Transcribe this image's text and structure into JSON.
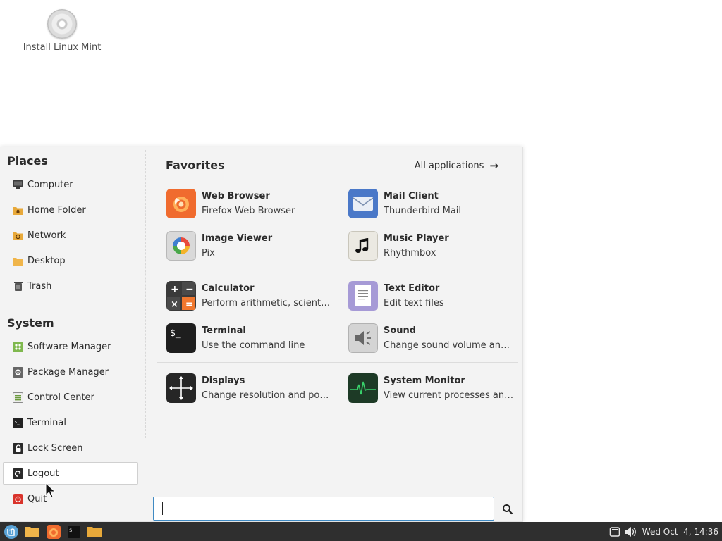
{
  "desktop": {
    "icons": [
      {
        "label": "Install Linux Mint",
        "icon": "disc-icon"
      }
    ]
  },
  "menu": {
    "places": {
      "title": "Places",
      "items": [
        {
          "label": "Computer",
          "icon": "computer-icon"
        },
        {
          "label": "Home Folder",
          "icon": "home-folder-icon"
        },
        {
          "label": "Network",
          "icon": "network-icon"
        },
        {
          "label": "Desktop",
          "icon": "desktop-folder-icon"
        },
        {
          "label": "Trash",
          "icon": "trash-icon"
        }
      ]
    },
    "system": {
      "title": "System",
      "items": [
        {
          "label": "Software Manager",
          "icon": "software-manager-icon"
        },
        {
          "label": "Package Manager",
          "icon": "package-manager-icon"
        },
        {
          "label": "Control Center",
          "icon": "control-center-icon"
        },
        {
          "label": "Terminal",
          "icon": "terminal-icon"
        },
        {
          "label": "Lock Screen",
          "icon": "lock-icon"
        },
        {
          "label": "Logout",
          "icon": "logout-icon"
        },
        {
          "label": "Quit",
          "icon": "power-icon"
        }
      ]
    },
    "favorites": {
      "title": "Favorites",
      "all_apps_label": "All applications",
      "apps": [
        {
          "name": "Web Browser",
          "desc": "Firefox Web Browser",
          "icon": "firefox-icon"
        },
        {
          "name": "Mail Client",
          "desc": "Thunderbird Mail",
          "icon": "mail-icon"
        },
        {
          "name": "Image Viewer",
          "desc": "Pix",
          "icon": "image-viewer-icon"
        },
        {
          "name": "Music Player",
          "desc": "Rhythmbox",
          "icon": "music-icon"
        },
        {
          "name": "Calculator",
          "desc": "Perform arithmetic, scientific or financial calculations",
          "icon": "calculator-icon"
        },
        {
          "name": "Text Editor",
          "desc": "Edit text files",
          "icon": "text-editor-icon"
        },
        {
          "name": "Terminal",
          "desc": "Use the command line",
          "icon": "terminal-icon"
        },
        {
          "name": "Sound",
          "desc": "Change sound volume and sound events",
          "icon": "sound-icon"
        },
        {
          "name": "Displays",
          "desc": "Change resolution and position of monitors",
          "icon": "displays-icon"
        },
        {
          "name": "System Monitor",
          "desc": "View current processes and monitor system state",
          "icon": "system-monitor-icon"
        }
      ]
    },
    "search": {
      "value": "",
      "placeholder": ""
    }
  },
  "taskbar": {
    "launchers": [
      "menu-icon",
      "files-icon",
      "firefox-icon",
      "terminal-icon",
      "folder-icon"
    ],
    "clock": "Wed Oct  4, 14:36"
  },
  "colors": {
    "taskbar": "#2f2f2f",
    "accent": "#3f8ac3",
    "mint": "#5aa3d6"
  }
}
